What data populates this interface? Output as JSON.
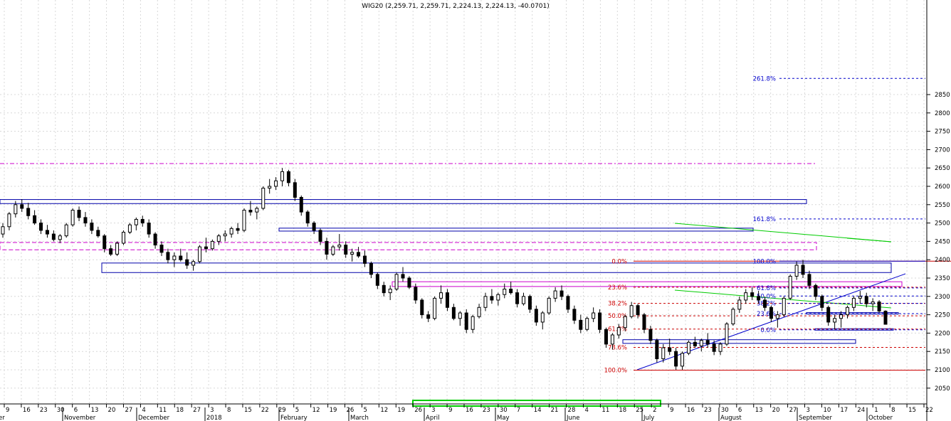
{
  "chart_data": {
    "type": "candlestick",
    "title": "WIG20 (2,259.71, 2,259.71, 2,224.13, 2,224.13, -40.0701)",
    "ylim": [
      2040,
      2900
    ],
    "y_ticks": [
      2050,
      2100,
      2150,
      2200,
      2250,
      2300,
      2350,
      2400,
      2450,
      2500,
      2550,
      2600,
      2650,
      2700,
      2750,
      2800,
      2850
    ],
    "y_tick_labels": [
      "2050",
      "2100",
      "2150",
      "2200",
      "2250",
      "2300",
      "2350",
      "2400",
      "2450",
      "2500",
      "2550",
      "2600",
      "2650",
      "2700",
      "2750",
      "2800",
      "2850"
    ],
    "grid": true,
    "x_day_labels": [
      "9",
      "16",
      "23",
      "30",
      "6",
      "13",
      "20",
      "27",
      "4",
      "11",
      "18",
      "27",
      "3",
      "8",
      "15",
      "22",
      "29",
      "5",
      "12",
      "19",
      "26",
      "5",
      "12",
      "19",
      "26",
      "3",
      "9",
      "16",
      "23",
      "30",
      "7",
      "14",
      "21",
      "28",
      "4",
      "11",
      "18",
      "25",
      "2",
      "9",
      "16",
      "23",
      "30",
      "6",
      "13",
      "20",
      "27",
      "3",
      "10",
      "17",
      "24",
      "1",
      "8",
      "15",
      "22"
    ],
    "x_month_labels": [
      "er",
      "November",
      "December",
      "2018",
      "February",
      "March",
      "April",
      "May",
      "June",
      "July",
      "August",
      "September",
      "October"
    ],
    "fibonacci": [
      {
        "label": "0.0%",
        "value": 2396
      },
      {
        "label": "23.6%",
        "value": 2325
      },
      {
        "label": "38.2%",
        "value": 2281
      },
      {
        "label": "50.0%",
        "value": 2247
      },
      {
        "label": "61.8%",
        "value": 2211
      },
      {
        "label": "78.6%",
        "value": 2161
      },
      {
        "label": "100.0%",
        "value": 2099
      },
      {
        "label": "261.8%",
        "value": 2894
      },
      {
        "label": "161.8%",
        "value": 2511
      },
      {
        "label": "100.0%",
        "value": 2396
      },
      {
        "label": "61.8%",
        "value": 2323
      },
      {
        "label": "50.0%",
        "value": 2301
      },
      {
        "label": "38.2%",
        "value": 2281
      },
      {
        "label": "23.6%",
        "value": 2253
      },
      {
        "label": "0.0%",
        "value": 2209
      }
    ],
    "zones": [
      {
        "low": 2553,
        "high": 2564,
        "color": "#0000aa"
      },
      {
        "low": 2478,
        "high": 2486,
        "color": "#0000aa"
      },
      {
        "low": 2365,
        "high": 2391,
        "color": "#0000aa"
      },
      {
        "low": 2427,
        "high": 2447,
        "color": "#cc00cc"
      },
      {
        "low": 2327,
        "high": 2340,
        "color": "#cc00cc"
      },
      {
        "low": 2172,
        "high": 2182,
        "color": "#0000aa"
      },
      {
        "low": 2252,
        "high": 2256,
        "color": "#0000aa"
      },
      {
        "low": 2208,
        "high": 2212,
        "color": "#0000aa"
      }
    ],
    "series": [
      {
        "values": [
          [
            2470,
            2500,
            2460,
            2490
          ],
          [
            2490,
            2530,
            2480,
            2525
          ],
          [
            2525,
            2560,
            2515,
            2550
          ],
          [
            2550,
            2565,
            2530,
            2540
          ],
          [
            2540,
            2555,
            2510,
            2520
          ],
          [
            2520,
            2535,
            2495,
            2500
          ],
          [
            2500,
            2510,
            2470,
            2480
          ],
          [
            2480,
            2495,
            2460,
            2470
          ],
          [
            2470,
            2480,
            2450,
            2455
          ],
          [
            2455,
            2470,
            2445,
            2465
          ],
          [
            2465,
            2500,
            2460,
            2495
          ],
          [
            2495,
            2540,
            2490,
            2535
          ],
          [
            2535,
            2545,
            2505,
            2515
          ],
          [
            2515,
            2530,
            2490,
            2500
          ],
          [
            2500,
            2510,
            2470,
            2480
          ],
          [
            2480,
            2490,
            2460,
            2465
          ],
          [
            2465,
            2470,
            2420,
            2430
          ],
          [
            2430,
            2440,
            2410,
            2415
          ],
          [
            2415,
            2450,
            2410,
            2445
          ],
          [
            2445,
            2480,
            2440,
            2475
          ],
          [
            2475,
            2500,
            2470,
            2495
          ],
          [
            2495,
            2515,
            2480,
            2510
          ],
          [
            2510,
            2520,
            2490,
            2500
          ],
          [
            2500,
            2510,
            2460,
            2470
          ],
          [
            2470,
            2475,
            2430,
            2440
          ],
          [
            2440,
            2450,
            2410,
            2420
          ],
          [
            2420,
            2430,
            2390,
            2400
          ],
          [
            2400,
            2420,
            2380,
            2410
          ],
          [
            2410,
            2430,
            2395,
            2400
          ],
          [
            2400,
            2420,
            2375,
            2385
          ],
          [
            2385,
            2400,
            2370,
            2395
          ],
          [
            2395,
            2440,
            2390,
            2435
          ],
          [
            2435,
            2460,
            2420,
            2430
          ],
          [
            2430,
            2455,
            2425,
            2450
          ],
          [
            2450,
            2470,
            2440,
            2465
          ],
          [
            2465,
            2480,
            2450,
            2470
          ],
          [
            2470,
            2490,
            2460,
            2485
          ],
          [
            2485,
            2500,
            2470,
            2480
          ],
          [
            2480,
            2540,
            2475,
            2535
          ],
          [
            2535,
            2560,
            2520,
            2530
          ],
          [
            2530,
            2545,
            2510,
            2540
          ],
          [
            2540,
            2600,
            2535,
            2595
          ],
          [
            2595,
            2620,
            2580,
            2600
          ],
          [
            2600,
            2625,
            2590,
            2615
          ],
          [
            2615,
            2650,
            2600,
            2640
          ],
          [
            2640,
            2645,
            2600,
            2610
          ],
          [
            2610,
            2620,
            2560,
            2570
          ],
          [
            2570,
            2575,
            2520,
            2530
          ],
          [
            2530,
            2535,
            2490,
            2500
          ],
          [
            2500,
            2505,
            2470,
            2480
          ],
          [
            2480,
            2485,
            2440,
            2450
          ],
          [
            2450,
            2460,
            2400,
            2415
          ],
          [
            2415,
            2440,
            2410,
            2435
          ],
          [
            2435,
            2470,
            2425,
            2440
          ],
          [
            2440,
            2450,
            2405,
            2415
          ],
          [
            2415,
            2430,
            2395,
            2420
          ],
          [
            2420,
            2435,
            2405,
            2410
          ],
          [
            2410,
            2425,
            2380,
            2390
          ],
          [
            2390,
            2395,
            2350,
            2360
          ],
          [
            2360,
            2365,
            2320,
            2330
          ],
          [
            2330,
            2340,
            2300,
            2310
          ],
          [
            2310,
            2330,
            2290,
            2320
          ],
          [
            2320,
            2365,
            2315,
            2360
          ],
          [
            2360,
            2380,
            2340,
            2350
          ],
          [
            2350,
            2355,
            2320,
            2325
          ],
          [
            2325,
            2335,
            2280,
            2290
          ],
          [
            2290,
            2295,
            2240,
            2250
          ],
          [
            2250,
            2260,
            2230,
            2240
          ],
          [
            2240,
            2300,
            2235,
            2295
          ],
          [
            2295,
            2330,
            2280,
            2310
          ],
          [
            2310,
            2320,
            2260,
            2270
          ],
          [
            2270,
            2280,
            2235,
            2240
          ],
          [
            2240,
            2260,
            2220,
            2255
          ],
          [
            2255,
            2265,
            2200,
            2210
          ],
          [
            2210,
            2250,
            2200,
            2245
          ],
          [
            2245,
            2280,
            2240,
            2270
          ],
          [
            2270,
            2310,
            2260,
            2300
          ],
          [
            2300,
            2320,
            2280,
            2290
          ],
          [
            2290,
            2310,
            2275,
            2305
          ],
          [
            2305,
            2335,
            2295,
            2320
          ],
          [
            2320,
            2340,
            2305,
            2310
          ],
          [
            2310,
            2320,
            2270,
            2280
          ],
          [
            2280,
            2310,
            2275,
            2300
          ],
          [
            2300,
            2305,
            2255,
            2265
          ],
          [
            2265,
            2275,
            2220,
            2230
          ],
          [
            2230,
            2260,
            2210,
            2255
          ],
          [
            2255,
            2300,
            2250,
            2295
          ],
          [
            2295,
            2325,
            2285,
            2315
          ],
          [
            2315,
            2330,
            2290,
            2300
          ],
          [
            2300,
            2305,
            2255,
            2265
          ],
          [
            2265,
            2275,
            2225,
            2235
          ],
          [
            2235,
            2250,
            2200,
            2210
          ],
          [
            2210,
            2245,
            2205,
            2240
          ],
          [
            2240,
            2270,
            2230,
            2255
          ],
          [
            2255,
            2265,
            2200,
            2210
          ],
          [
            2210,
            2215,
            2160,
            2170
          ],
          [
            2170,
            2200,
            2155,
            2195
          ],
          [
            2195,
            2225,
            2185,
            2215
          ],
          [
            2215,
            2250,
            2205,
            2245
          ],
          [
            2245,
            2285,
            2240,
            2275
          ],
          [
            2275,
            2280,
            2240,
            2250
          ],
          [
            2250,
            2255,
            2200,
            2210
          ],
          [
            2210,
            2220,
            2170,
            2180
          ],
          [
            2180,
            2185,
            2120,
            2130
          ],
          [
            2130,
            2170,
            2120,
            2160
          ],
          [
            2160,
            2185,
            2140,
            2150
          ],
          [
            2150,
            2160,
            2100,
            2110
          ],
          [
            2110,
            2150,
            2100,
            2145
          ],
          [
            2145,
            2180,
            2140,
            2175
          ],
          [
            2175,
            2190,
            2160,
            2165
          ],
          [
            2165,
            2185,
            2150,
            2180
          ],
          [
            2180,
            2200,
            2160,
            2170
          ],
          [
            2170,
            2180,
            2140,
            2150
          ],
          [
            2150,
            2175,
            2140,
            2170
          ],
          [
            2170,
            2230,
            2165,
            2225
          ],
          [
            2225,
            2270,
            2220,
            2265
          ],
          [
            2265,
            2300,
            2255,
            2290
          ],
          [
            2290,
            2320,
            2280,
            2310
          ],
          [
            2310,
            2325,
            2290,
            2300
          ],
          [
            2300,
            2315,
            2280,
            2290
          ],
          [
            2290,
            2300,
            2260,
            2270
          ],
          [
            2270,
            2275,
            2230,
            2240
          ],
          [
            2240,
            2260,
            2215,
            2250
          ],
          [
            2250,
            2300,
            2245,
            2295
          ],
          [
            2295,
            2360,
            2290,
            2355
          ],
          [
            2355,
            2395,
            2345,
            2385
          ],
          [
            2385,
            2400,
            2350,
            2360
          ],
          [
            2360,
            2370,
            2320,
            2330
          ],
          [
            2330,
            2335,
            2290,
            2300
          ],
          [
            2300,
            2305,
            2260,
            2270
          ],
          [
            2270,
            2275,
            2220,
            2230
          ],
          [
            2230,
            2250,
            2210,
            2240
          ],
          [
            2240,
            2260,
            2215,
            2250
          ],
          [
            2250,
            2275,
            2240,
            2270
          ],
          [
            2270,
            2300,
            2260,
            2295
          ],
          [
            2295,
            2315,
            2280,
            2300
          ],
          [
            2300,
            2310,
            2270,
            2280
          ],
          [
            2280,
            2295,
            2260,
            2285
          ],
          [
            2285,
            2290,
            2255,
            2260
          ],
          [
            2260,
            2262,
            2224,
            2224
          ]
        ]
      }
    ]
  }
}
